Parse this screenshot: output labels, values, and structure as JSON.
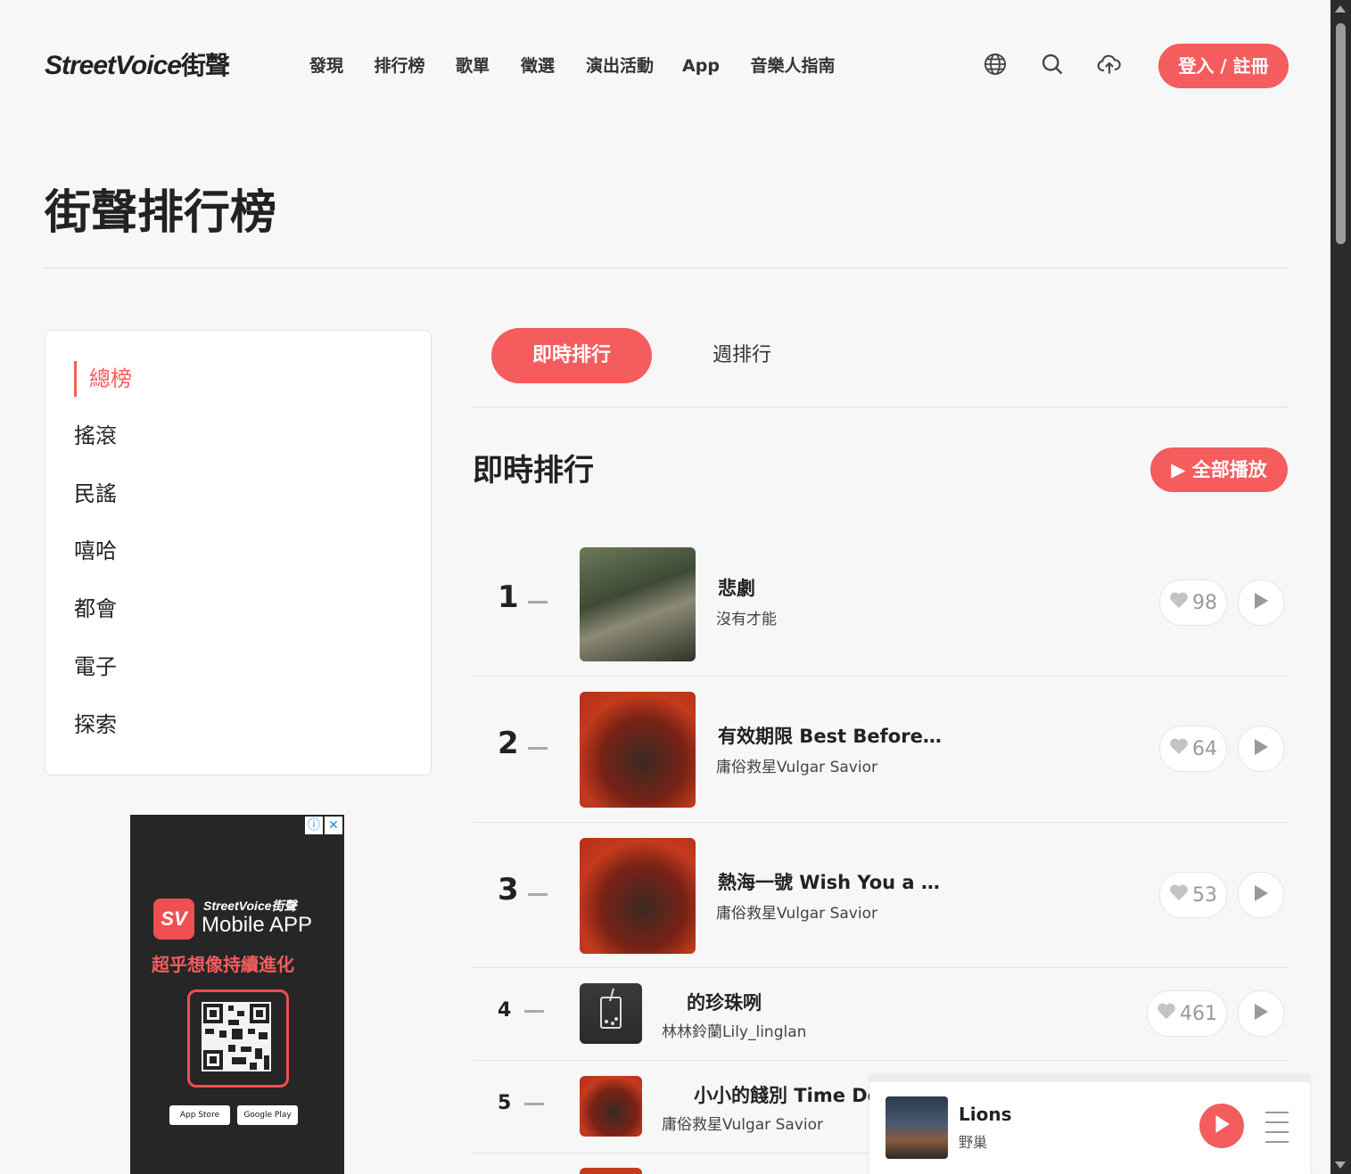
{
  "header": {
    "logo_text": "StreetVoice",
    "logo_cjk": "街聲",
    "nav": [
      "發現",
      "排行榜",
      "歌單",
      "徵選",
      "演出活動",
      "App",
      "音樂人指南"
    ],
    "icons": [
      "globe-icon",
      "search-icon",
      "upload-cloud-icon"
    ],
    "login_label": "登入 / 註冊"
  },
  "page": {
    "title": "街聲排行榜"
  },
  "sidebar": {
    "categories": [
      {
        "label": "總榜",
        "active": true
      },
      {
        "label": "搖滾",
        "active": false
      },
      {
        "label": "民謠",
        "active": false
      },
      {
        "label": "嘻哈",
        "active": false
      },
      {
        "label": "都會",
        "active": false
      },
      {
        "label": "電子",
        "active": false
      },
      {
        "label": "探索",
        "active": false
      }
    ]
  },
  "ad": {
    "brand": "StreetVoice街聲",
    "logo_mark": "SV",
    "app_label": "Mobile APP",
    "slogan": "超乎想像持續進化",
    "store_apple": "App Store",
    "store_google": "Google Play",
    "info_icon": "ⓘ",
    "close_icon": "✕"
  },
  "main": {
    "tabs": [
      {
        "label": "即時排行",
        "active": true
      },
      {
        "label": "週排行",
        "active": false
      }
    ],
    "section_title": "即時排行",
    "play_all_label": "全部播放"
  },
  "chart_rows": [
    {
      "rank": "1",
      "title": "悲劇",
      "artist": "沒有才能",
      "likes": "98"
    },
    {
      "rank": "2",
      "title": "有效期限 Best Before…",
      "artist": "庸俗救星Vulgar Savior",
      "likes": "64"
    },
    {
      "rank": "3",
      "title": "熱海一號 Wish You a …",
      "artist": "庸俗救星Vulgar Savior",
      "likes": "53"
    },
    {
      "rank": "4",
      "title": "的珍珠咧",
      "artist": "林林鈴蘭Lily_linglan",
      "likes": "461"
    },
    {
      "rank": "5",
      "title": "小小的餞別 Time Do",
      "artist": "庸俗救星Vulgar Savior",
      "likes": ""
    }
  ],
  "player": {
    "title": "Lions",
    "artist": "野巢"
  },
  "colors": {
    "accent": "#f45c5e"
  }
}
